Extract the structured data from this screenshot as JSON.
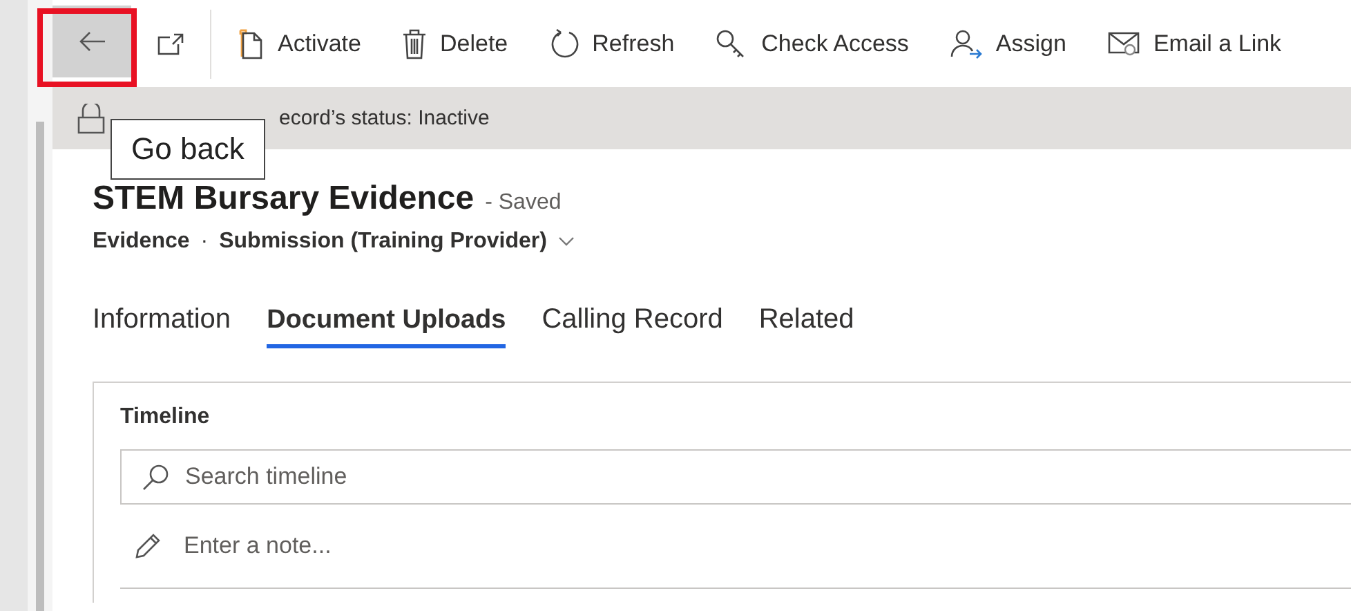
{
  "toolbar": {
    "back_button": {
      "highlighted": true,
      "tooltip": "Go back"
    },
    "commands": [
      {
        "label": "Activate"
      },
      {
        "label": "Delete"
      },
      {
        "label": "Refresh"
      },
      {
        "label": "Check Access"
      },
      {
        "label": "Assign"
      },
      {
        "label": "Email a Link"
      }
    ]
  },
  "banner": {
    "text": "ecord’s status: Inactive"
  },
  "header": {
    "title": "STEM Bursary Evidence",
    "save_status": "- Saved",
    "entity": "Evidence",
    "separator": "·",
    "form": "Submission (Training Provider)"
  },
  "tabs": [
    {
      "label": "Information",
      "selected": false
    },
    {
      "label": "Document Uploads",
      "selected": true
    },
    {
      "label": "Calling Record",
      "selected": false
    },
    {
      "label": "Related",
      "selected": false
    }
  ],
  "timeline": {
    "title": "Timeline",
    "search": {
      "placeholder": "Search timeline"
    },
    "note": {
      "placeholder": "Enter a note..."
    }
  }
}
